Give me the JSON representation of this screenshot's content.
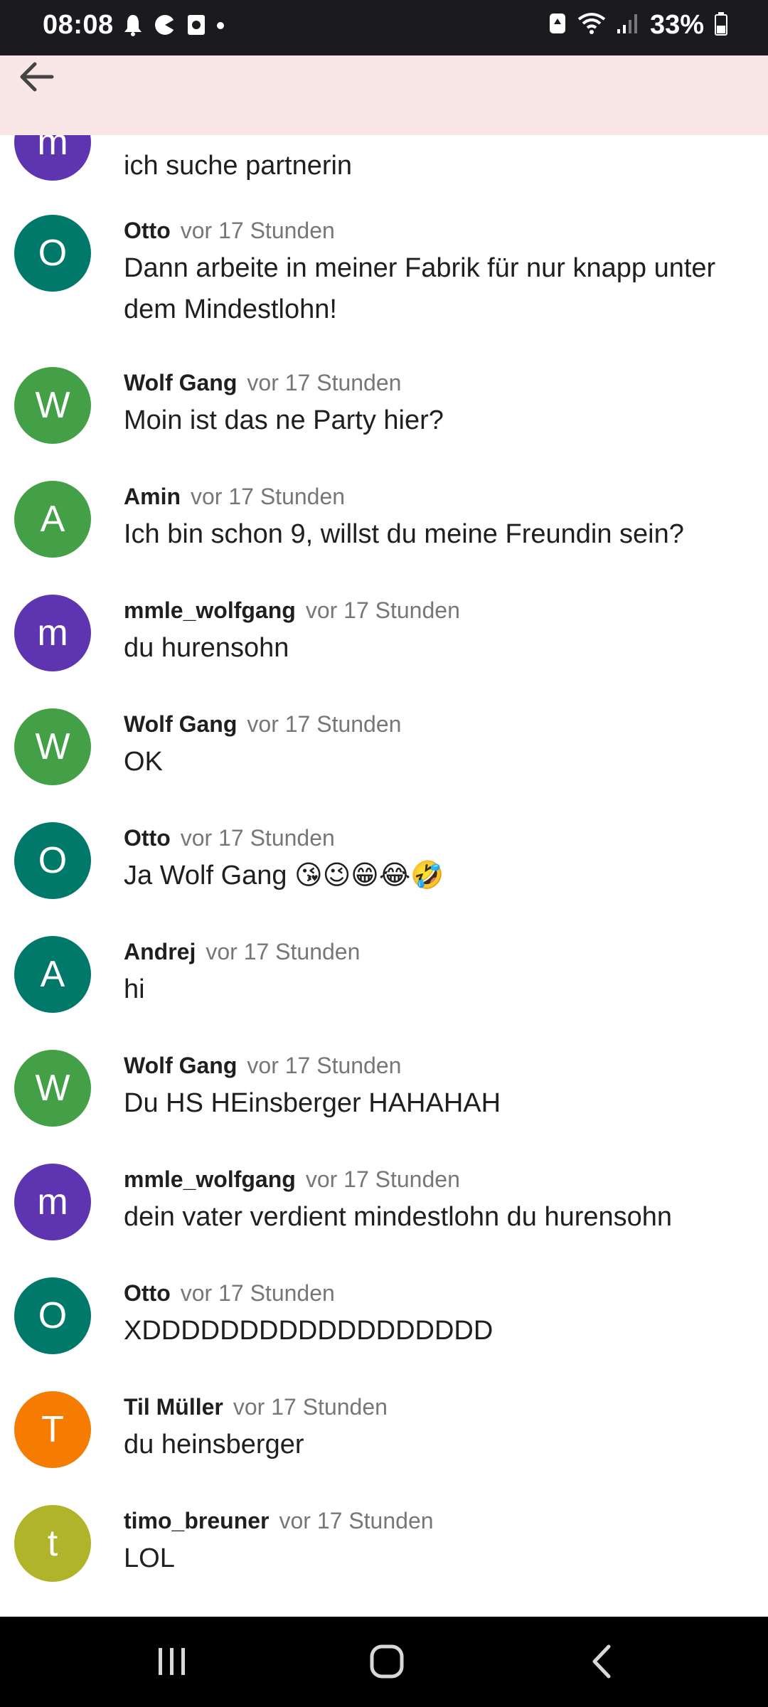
{
  "status_bar": {
    "time": "08:08",
    "battery_percent": "33%",
    "left_icons": [
      "notification-icon",
      "app-icon",
      "screenshot-icon",
      "dot-icon"
    ],
    "right_icons": [
      "recycle-icon",
      "wifi-icon",
      "signal-icon",
      "battery-icon"
    ]
  },
  "app_bar": {
    "back_icon": "arrow-back-icon",
    "background": "#f9e6e7"
  },
  "messages": [
    {
      "initial": "m",
      "color": "#5e35b1",
      "author": "",
      "time": "",
      "text": "ich suche partnerin"
    },
    {
      "initial": "O",
      "color": "#00796b",
      "author": "Otto",
      "time": "vor 17 Stunden",
      "text": "Dann arbeite in meiner Fabrik für nur knapp unter dem Mindestlohn!"
    },
    {
      "initial": "W",
      "color": "#43a047",
      "author": "Wolf Gang",
      "time": "vor 17 Stunden",
      "text": "Moin ist das ne Party hier?"
    },
    {
      "initial": "A",
      "color": "#43a047",
      "author": "Amin",
      "time": "vor 17 Stunden",
      "text": "Ich bin schon 9, willst du meine Freundin sein?"
    },
    {
      "initial": "m",
      "color": "#5e35b1",
      "author": "mmle_wolfgang",
      "time": "vor 17 Stunden",
      "text": "du hurensohn"
    },
    {
      "initial": "W",
      "color": "#43a047",
      "author": "Wolf Gang",
      "time": "vor 17 Stunden",
      "text": "OK"
    },
    {
      "initial": "O",
      "color": "#00796b",
      "author": "Otto",
      "time": "vor 17 Stunden",
      "text": "Ja Wolf Gang 😘😉😁😂🤣"
    },
    {
      "initial": "A",
      "color": "#00796b",
      "author": "Andrej",
      "time": "vor 17 Stunden",
      "text": "hi"
    },
    {
      "initial": "W",
      "color": "#43a047",
      "author": "Wolf Gang",
      "time": "vor 17 Stunden",
      "text": "Du HS HEinsberger HAHAHAH"
    },
    {
      "initial": "m",
      "color": "#5e35b1",
      "author": "mmle_wolfgang",
      "time": "vor 17 Stunden",
      "text": "dein vater verdient mindestlohn du hurensohn"
    },
    {
      "initial": "O",
      "color": "#00796b",
      "author": "Otto",
      "time": "vor 17 Stunden",
      "text": "XDDDDDDDDDDDDDDDDDD"
    },
    {
      "initial": "T",
      "color": "#f57c00",
      "author": "Til Müller",
      "time": "vor 17 Stunden",
      "text": "du heinsberger"
    },
    {
      "initial": "t",
      "color": "#afb42b",
      "author": "timo_breuner",
      "time": "vor 17 Stunden",
      "text": "LOL"
    }
  ],
  "nav_bar": {
    "buttons": [
      "recents-icon",
      "home-icon",
      "back-icon"
    ]
  }
}
